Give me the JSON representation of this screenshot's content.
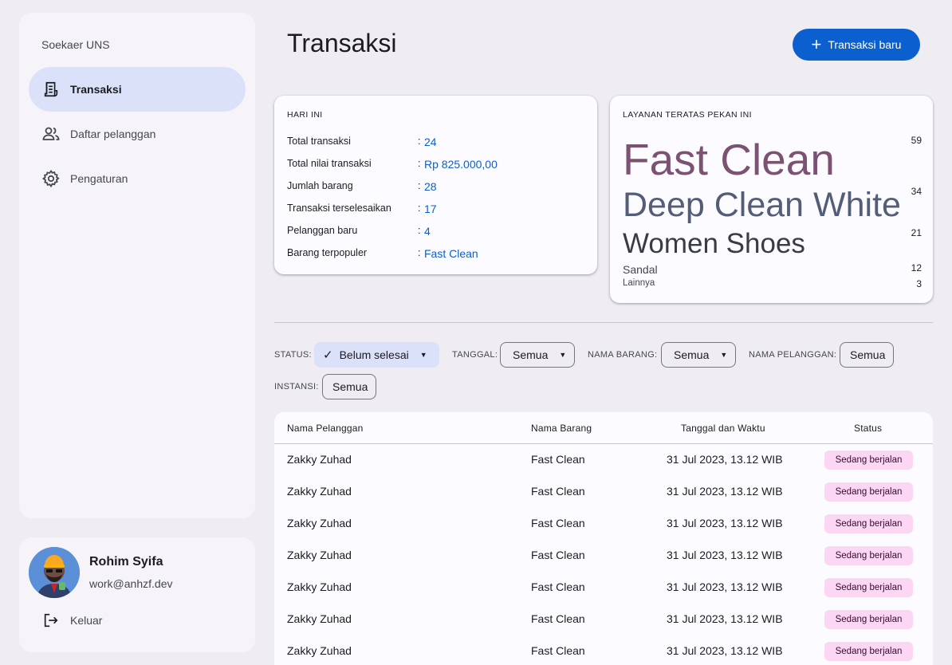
{
  "app": {
    "name": "Soekaer UNS"
  },
  "nav": {
    "items": [
      {
        "label": "Transaksi",
        "icon": "receipt-icon",
        "active": true
      },
      {
        "label": "Daftar pelanggan",
        "icon": "people-icon",
        "active": false
      },
      {
        "label": "Pengaturan",
        "icon": "gear-icon",
        "active": false
      }
    ]
  },
  "profile": {
    "name": "Rohim Syifa",
    "email": "work@anhzf.dev",
    "logout_label": "Keluar"
  },
  "page": {
    "title": "Transaksi",
    "new_button_label": "Transaksi baru"
  },
  "today": {
    "heading": "HARI INI",
    "stats": [
      {
        "label": "Total transaksi",
        "value": "24"
      },
      {
        "label": "Total nilai transaksi",
        "value": "Rp 825.000,00"
      },
      {
        "label": "Jumlah barang",
        "value": "28"
      },
      {
        "label": "Transaksi terselesaikan",
        "value": "17"
      },
      {
        "label": "Pelanggan baru",
        "value": "4"
      },
      {
        "label": "Barang terpopuler",
        "value": "Fast Clean"
      }
    ]
  },
  "top_services": {
    "heading": "LAYANAN TERATAS PEKAN INI",
    "items": [
      {
        "name": "Fast Clean",
        "count": "59"
      },
      {
        "name": "Deep Clean White",
        "count": "34"
      },
      {
        "name": "Women Shoes",
        "count": "21"
      },
      {
        "name": "Sandal",
        "count": "12"
      },
      {
        "name": "Lainnya",
        "count": "3"
      }
    ]
  },
  "filters": {
    "status": {
      "label": "STATUS:",
      "value": "Belum selesai"
    },
    "tanggal": {
      "label": "TANGGAL:",
      "value": "Semua"
    },
    "nama_barang": {
      "label": "NAMA BARANG:",
      "value": "Semua"
    },
    "nama_pelanggan": {
      "label": "NAMA PELANGGAN:",
      "value": "Semua"
    },
    "instansi": {
      "label": "INSTANSI:",
      "value": "Semua"
    }
  },
  "table": {
    "headers": [
      "Nama Pelanggan",
      "Nama Barang",
      "Tanggal dan Waktu",
      "Status"
    ],
    "rows": [
      [
        "Zakky Zuhad",
        "Fast Clean",
        "31 Jul 2023, 13.12 WIB",
        "Sedang berjalan"
      ],
      [
        "Zakky Zuhad",
        "Fast Clean",
        "31 Jul 2023, 13.12 WIB",
        "Sedang berjalan"
      ],
      [
        "Zakky Zuhad",
        "Fast Clean",
        "31 Jul 2023, 13.12 WIB",
        "Sedang berjalan"
      ],
      [
        "Zakky Zuhad",
        "Fast Clean",
        "31 Jul 2023, 13.12 WIB",
        "Sedang berjalan"
      ],
      [
        "Zakky Zuhad",
        "Fast Clean",
        "31 Jul 2023, 13.12 WIB",
        "Sedang berjalan"
      ],
      [
        "Zakky Zuhad",
        "Fast Clean",
        "31 Jul 2023, 13.12 WIB",
        "Sedang berjalan"
      ],
      [
        "Zakky Zuhad",
        "Fast Clean",
        "31 Jul 2023, 13.12 WIB",
        "Sedang berjalan"
      ]
    ]
  },
  "colors": {
    "background": "#efedf2",
    "accent": "#0b5fcf",
    "nav_active": "#dbe1f9",
    "badge_bg": "#fbd7f3",
    "top_service_1": "#7b5272",
    "top_service_2": "#545d77"
  }
}
